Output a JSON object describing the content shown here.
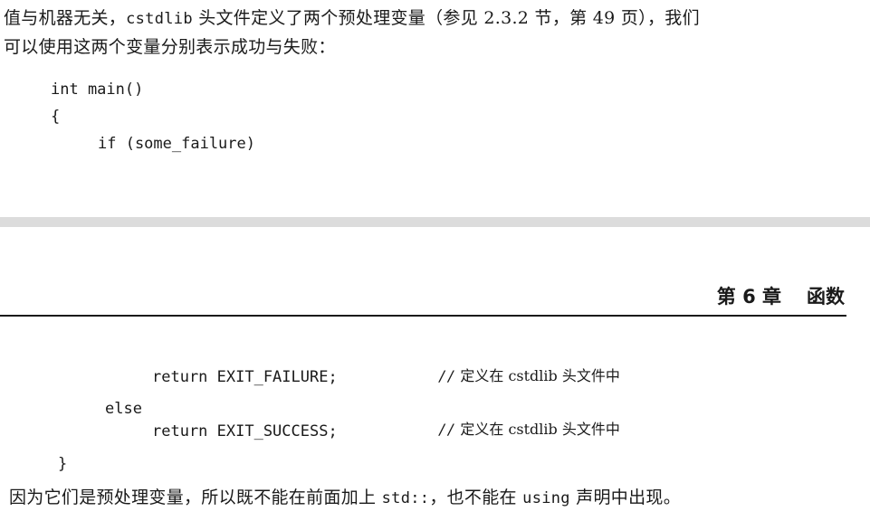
{
  "top_page": {
    "paragraph": {
      "line1_before": "值与机器无关，",
      "line1_code": "cstdlib",
      "line1_after": " 头文件定义了两个预处理变量（参见 2.3.2 节，第 49 页），我们",
      "line2": "可以使用这两个变量分别表示成功与失败："
    },
    "code": {
      "line1": "int main()",
      "line2": "{",
      "line3": "if (some_failure)"
    }
  },
  "bottom_page": {
    "running_head": {
      "chapter": "第 6 章",
      "title": "函数"
    },
    "code": {
      "return_failure": "return EXIT_FAILURE;",
      "comment1_slashes": "//",
      "comment1_text": "定义在 cstdlib 头文件中",
      "else_kw": "else",
      "return_success": "return EXIT_SUCCESS;",
      "comment2_slashes": "//",
      "comment2_text": "定义在 cstdlib 头文件中",
      "close_brace": "}"
    },
    "paragraph": {
      "before_std": "因为它们是预处理变量，所以既不能在前面加上 ",
      "std_code": "std::",
      "middle": "，也不能在 ",
      "using_code": "using",
      "after": " 声明中出现。"
    }
  }
}
